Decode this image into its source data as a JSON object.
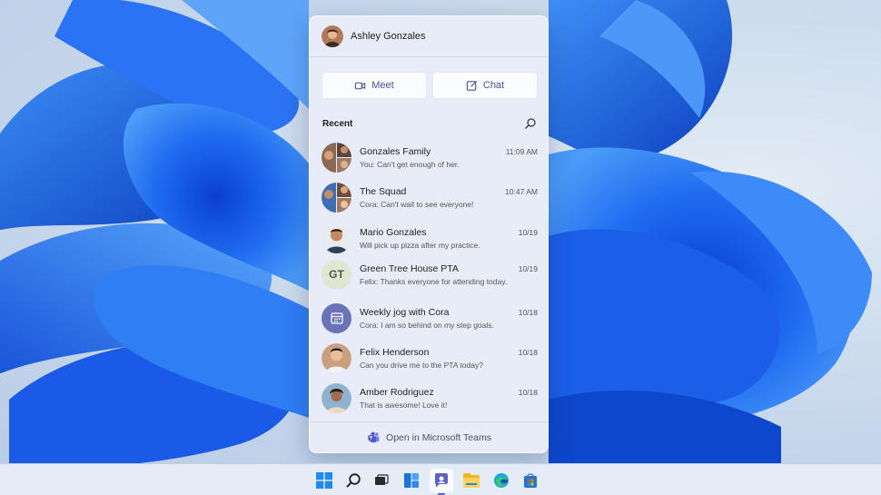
{
  "profile": {
    "name": "Ashley Gonzales"
  },
  "actions": {
    "meet_label": "Meet",
    "chat_label": "Chat"
  },
  "recent": {
    "title": "Recent"
  },
  "conversations": [
    {
      "name": "Gonzales Family",
      "time": "11:09 AM",
      "preview": "You: Can't get enough of her."
    },
    {
      "name": "The Squad",
      "time": "10:47 AM",
      "preview": "Cora: Can't wait to see everyone!"
    },
    {
      "name": "Mario Gonzales",
      "time": "10/19",
      "preview": "Will pick up pizza after my practice."
    },
    {
      "name": "Green Tree House PTA",
      "time": "10/19",
      "preview": "Felix: Thanks everyone for attending today.",
      "initials": "GT"
    },
    {
      "name": "Weekly jog with Cora",
      "time": "10/18",
      "preview": "Cora: I am so behind on my step goals."
    },
    {
      "name": "Felix Henderson",
      "time": "10/18",
      "preview": "Can you drive me to the PTA today?"
    },
    {
      "name": "Amber Rodriguez",
      "time": "10/18",
      "preview": "That is awesome! Love it!"
    }
  ],
  "footer": {
    "label": "Open in Microsoft Teams"
  },
  "colors": {
    "accent": "#5a61c8",
    "wallpaper_blue": "#1b5ee8"
  },
  "taskbar": {
    "icons": [
      "start-icon",
      "search-icon",
      "task-view-icon",
      "widgets-icon",
      "chat-icon",
      "file-explorer-icon",
      "edge-icon",
      "store-icon"
    ]
  }
}
